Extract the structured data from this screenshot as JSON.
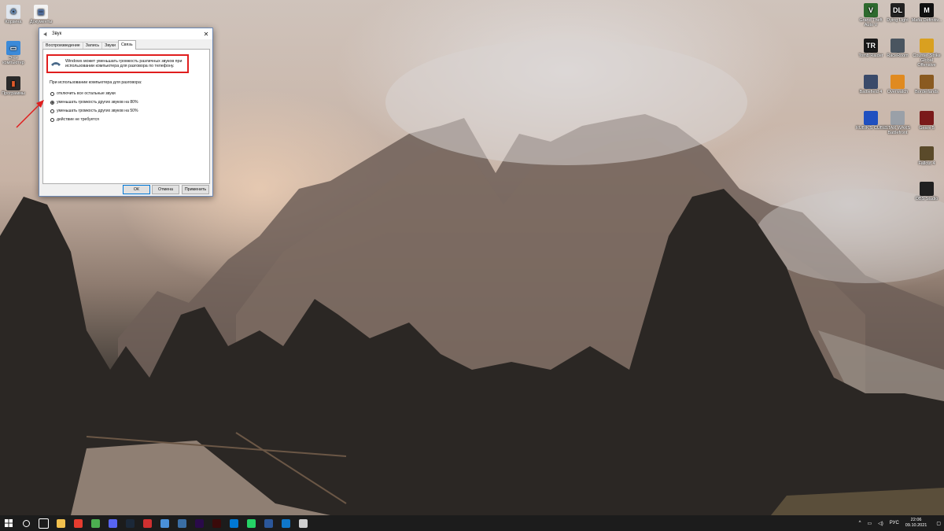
{
  "desktop": {
    "left_icons": [
      {
        "label": "Корзина",
        "icon": "recycle-bin-icon"
      },
      {
        "label": "Документы",
        "icon": "documents-icon"
      },
      {
        "label": "Этот компьютер",
        "icon": "this-pc-icon"
      },
      {
        "label": "Программы",
        "icon": "programs-icon"
      }
    ],
    "right_icons": [
      {
        "label": "Grand Theft Auto V",
        "icon": "gta-icon",
        "glyph": "V",
        "color": "#2e6a2e"
      },
      {
        "label": "Dying Light",
        "icon": "dying-light-icon",
        "glyph": "DL",
        "color": "#222222"
      },
      {
        "label": "Mafia Definitiv...",
        "icon": "mafia-icon",
        "glyph": "M",
        "color": "#111111"
      },
      {
        "label": "Tomb Raider",
        "icon": "tomb-raider-icon",
        "glyph": "TR",
        "color": "#1a1a1a"
      },
      {
        "label": "RaceRoom",
        "icon": "raceroom-icon",
        "glyph": "",
        "color": "#4a5560"
      },
      {
        "label": "Counter-Strike Global Offensive",
        "icon": "csgo-icon",
        "glyph": "",
        "color": "#d9a020"
      },
      {
        "label": "Battlefield 4",
        "icon": "battlefield-icon",
        "glyph": "",
        "color": "#3a4a6a"
      },
      {
        "label": "Overwatch",
        "icon": "overwatch-icon",
        "glyph": "",
        "color": "#e08a20"
      },
      {
        "label": "Borderlands",
        "icon": "borderlands-icon",
        "glyph": "",
        "color": "#8a5a20"
      },
      {
        "label": "RUBIK'S CUBE",
        "icon": "rubiks-cube-icon",
        "glyph": "",
        "color": "#2050c0"
      },
      {
        "label": "STAR WARS Battlefront",
        "icon": "star-wars-icon",
        "glyph": "",
        "color": "#9aa0a8"
      },
      {
        "label": "Gears 5",
        "icon": "gears-icon",
        "glyph": "",
        "color": "#7a1a1a"
      },
      {
        "label": "Fallout 4",
        "icon": "fallout-icon",
        "glyph": "",
        "color": "#5a4a2a"
      },
      {
        "label": "OBS Studio",
        "icon": "obs-icon",
        "glyph": "",
        "color": "#202020"
      }
    ]
  },
  "dialog": {
    "title": "Звук",
    "tabs": [
      "Воспроизведение",
      "Запись",
      "Звуки",
      "Связь"
    ],
    "active_tab": 3,
    "info_text_line1": "Windows может уменьшать громкость различных звуков при",
    "info_text_line2": "использовании компьютера для разговора по телефону.",
    "section_label": "При использовании компьютера для разговора:",
    "options": [
      {
        "label": "отключить все остальные звуки",
        "selected": false
      },
      {
        "label": "уменьшать громкость других звуков на 80%",
        "selected": true
      },
      {
        "label": "уменьшать громкость других звуков на 50%",
        "selected": false
      },
      {
        "label": "действие не требуется",
        "selected": false
      }
    ],
    "buttons": {
      "ok": "ОК",
      "cancel": "Отмена",
      "apply": "Применить"
    }
  },
  "annotation": {
    "arrow_color": "#e01e1e",
    "box_color": "#e01e1e"
  },
  "taskbar": {
    "apps": [
      {
        "icon": "search-icon",
        "color": "#1c1c1c"
      },
      {
        "icon": "task-view-icon",
        "color": "#1c1c1c"
      },
      {
        "icon": "file-explorer-icon",
        "color": "#f2c14e"
      },
      {
        "icon": "yandex-icon",
        "color": "#e63c2f"
      },
      {
        "icon": "chrome-icon",
        "color": "#4caf50"
      },
      {
        "icon": "discord-icon",
        "color": "#5865f2"
      },
      {
        "icon": "steam-icon",
        "color": "#1b2838"
      },
      {
        "icon": "app-64-icon",
        "color": "#d03030"
      },
      {
        "icon": "gallery-icon",
        "color": "#4a90d9"
      },
      {
        "icon": "calculator-icon",
        "color": "#3a6ea5"
      },
      {
        "icon": "premiere-icon",
        "color": "#2a0a4a"
      },
      {
        "icon": "animate-icon",
        "color": "#3a0a0a"
      },
      {
        "icon": "vscode-icon",
        "color": "#0078d4"
      },
      {
        "icon": "whatsapp-icon",
        "color": "#25d366"
      },
      {
        "icon": "word-icon",
        "color": "#2b579a"
      },
      {
        "icon": "store-icon",
        "color": "#0f77c9"
      },
      {
        "icon": "generic-app-icon",
        "color": "#d0d0d0"
      }
    ],
    "language": "РУС",
    "time": "22:06",
    "date": "09.10.2021"
  }
}
